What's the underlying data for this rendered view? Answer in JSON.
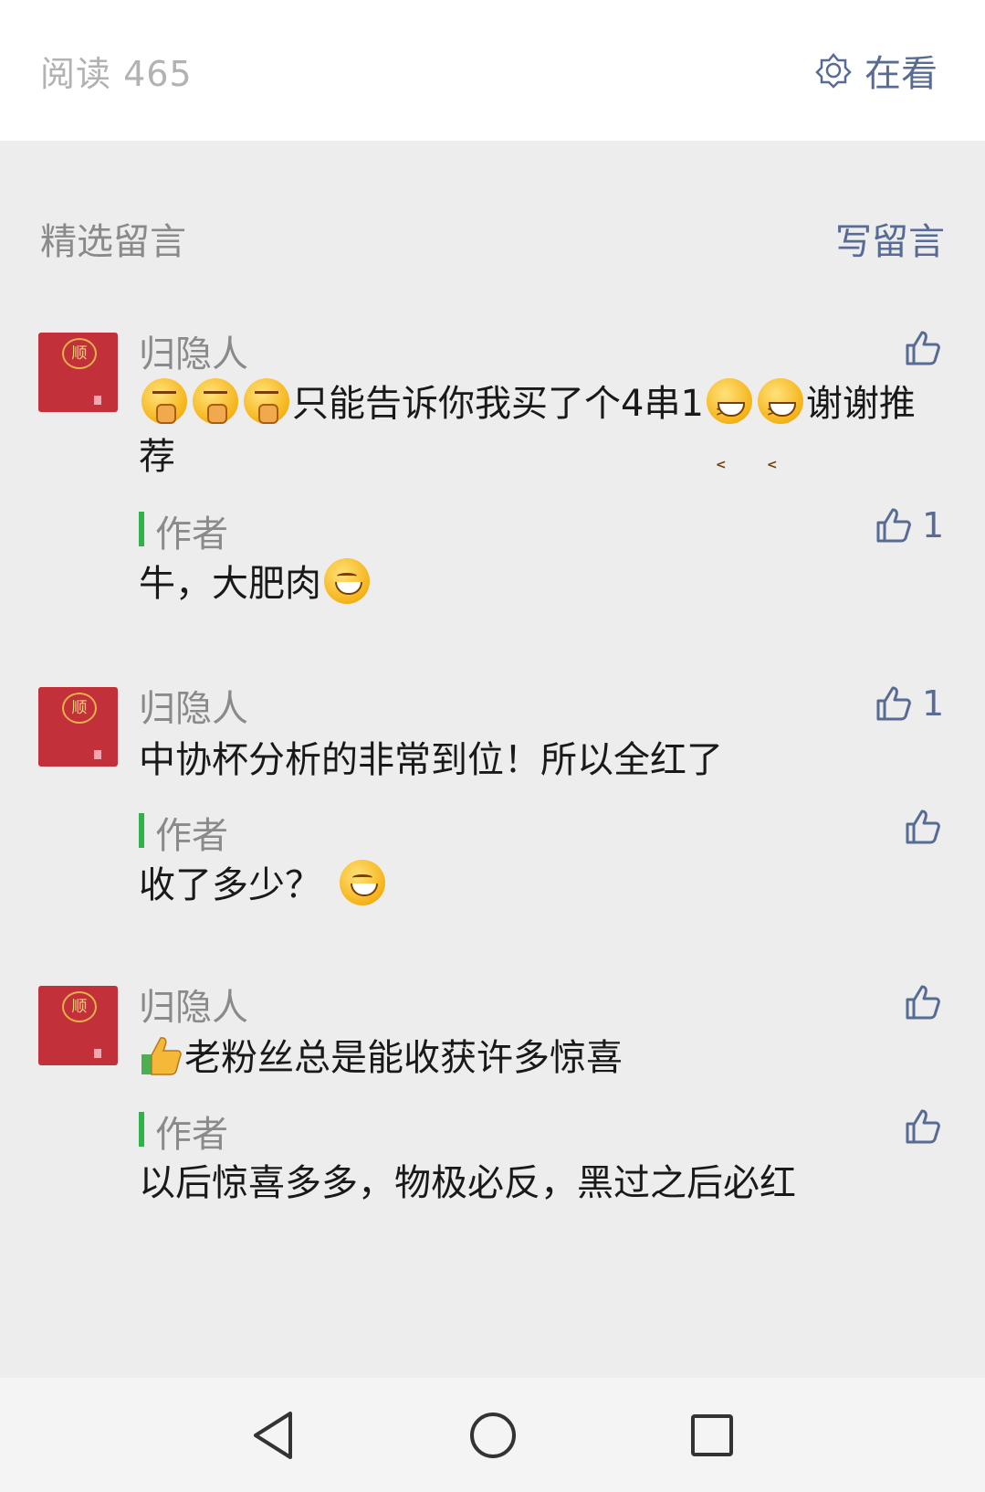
{
  "header": {
    "read_label": "阅读 465",
    "zaikan_label": "在看"
  },
  "section": {
    "title": "精选留言",
    "write_label": "写留言"
  },
  "comments": [
    {
      "author": "归隐人",
      "text_main": "只能告诉你我买了个4串1",
      "text_after": "谢谢推荐",
      "like_count": "",
      "reply": {
        "label": "作者",
        "text": "牛，大肥肉",
        "like_count": "1"
      }
    },
    {
      "author": "归隐人",
      "text_main": "中协杯分析的非常到位！所以全红了",
      "like_count": "1",
      "reply": {
        "label": "作者",
        "text": "收了多少？",
        "like_count": ""
      }
    },
    {
      "author": "归隐人",
      "text_main": "老粉丝总是能收获许多惊喜",
      "like_count": "",
      "reply": {
        "label": "作者",
        "text": "以后惊喜多多，物极必反，黑过之后必红",
        "like_count": ""
      }
    }
  ],
  "avatar": {
    "seal_char": "顺"
  },
  "colors": {
    "link": "#576b95",
    "author_bar": "#2db34a",
    "avatar_bg": "#c2313a"
  },
  "icons": [
    "zaikan-icon",
    "thumbs-up-icon",
    "back-icon",
    "home-icon",
    "recents-icon"
  ]
}
